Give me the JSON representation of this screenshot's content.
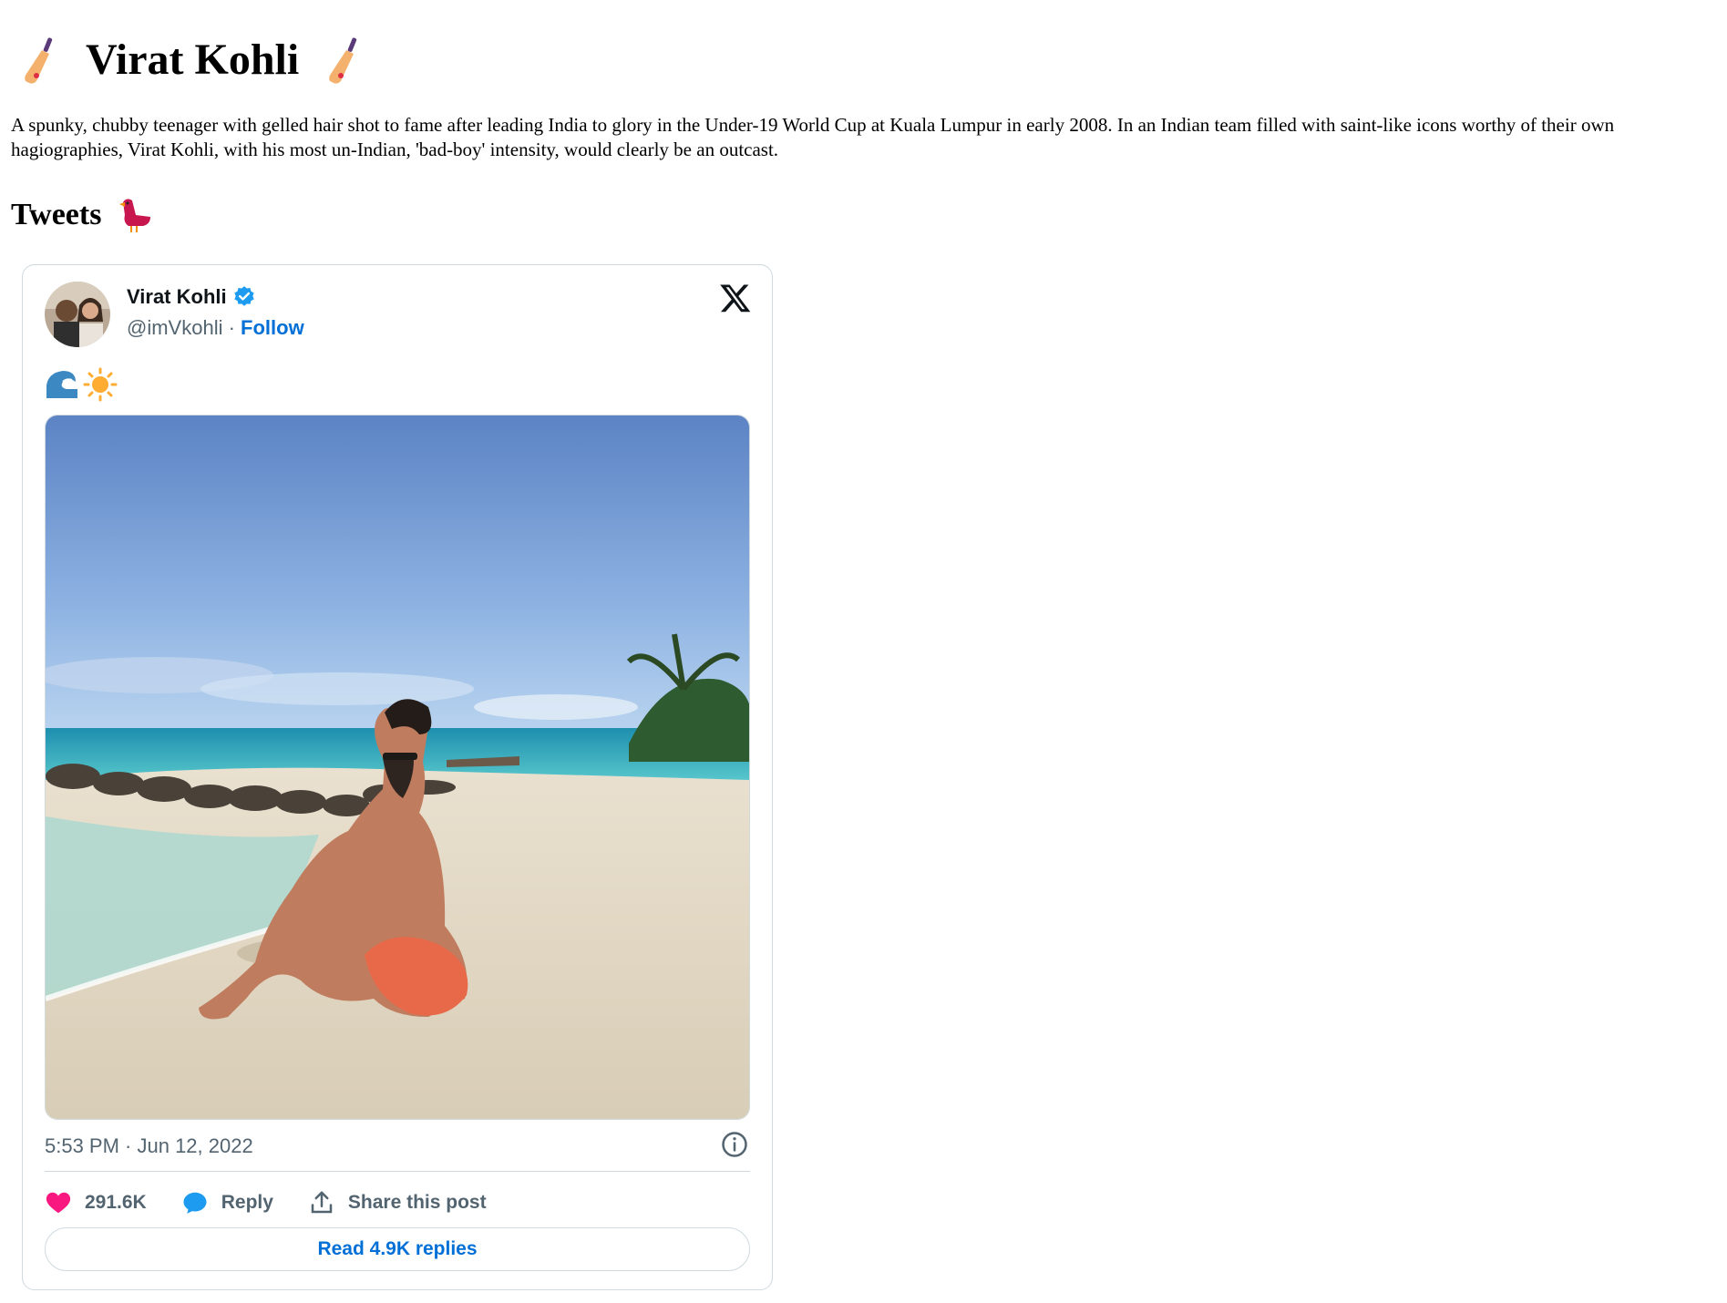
{
  "header": {
    "title": "Virat Kohli",
    "left_icon": "cricket-bat-icon",
    "right_icon": "cricket-bat-icon"
  },
  "bio": "A spunky, chubby teenager with gelled hair shot to fame after leading India to glory in the Under-19 World Cup at Kuala Lumpur in early 2008. In an Indian team filled with saint-like icons worthy of their own hagiographies, Virat Kohli, with his most un-Indian, 'bad-boy' intensity, would clearly be an outcast.",
  "tweets_section": {
    "title": "Tweets",
    "icon": "bird-icon"
  },
  "tweet": {
    "author_name": "Virat Kohli",
    "handle": "@imVkohli",
    "separator": " · ",
    "follow_label": "Follow",
    "text_emojis": [
      "wave-icon",
      "sun-icon"
    ],
    "timestamp": "5:53 PM · Jun 12, 2022",
    "likes": "291.6K",
    "reply_label": "Reply",
    "share_label": "Share this post",
    "read_replies_label": "Read 4.9K replies",
    "colors": {
      "link": "#006fd6",
      "muted": "#536471",
      "like": "#f91880",
      "reply": "#1d9bf0",
      "verified": "#1d9bf0"
    }
  }
}
